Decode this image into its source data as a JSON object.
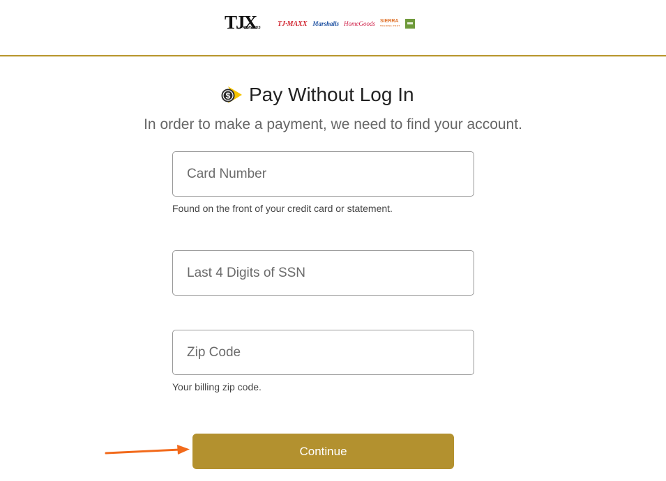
{
  "header": {
    "logos": {
      "tjx": "TJX",
      "tjx_sub": "REWARDS",
      "tjmaxx": "TJ·MAXX",
      "marshalls": "Marshalls",
      "homegoods": "HomeGoods",
      "sierra": "SIERRA",
      "sierra_tag": "TRADING POST"
    },
    "accent_color": "#b8952c"
  },
  "main": {
    "title_icon": "dollar-arrow-icon",
    "title": "Pay Without Log In",
    "subtitle": "In order to make a payment, we need to find your account."
  },
  "form": {
    "card_number": {
      "placeholder": "Card Number",
      "value": "",
      "help": "Found on the front of your credit card or statement."
    },
    "ssn": {
      "placeholder": "Last 4 Digits of SSN",
      "value": ""
    },
    "zip": {
      "placeholder": "Zip Code",
      "value": "",
      "help": "Your billing zip code."
    },
    "continue_label": "Continue",
    "button_color": "#b3912f"
  },
  "annotation": {
    "icon": "arrow-right-icon",
    "color": "#f26a1b"
  }
}
